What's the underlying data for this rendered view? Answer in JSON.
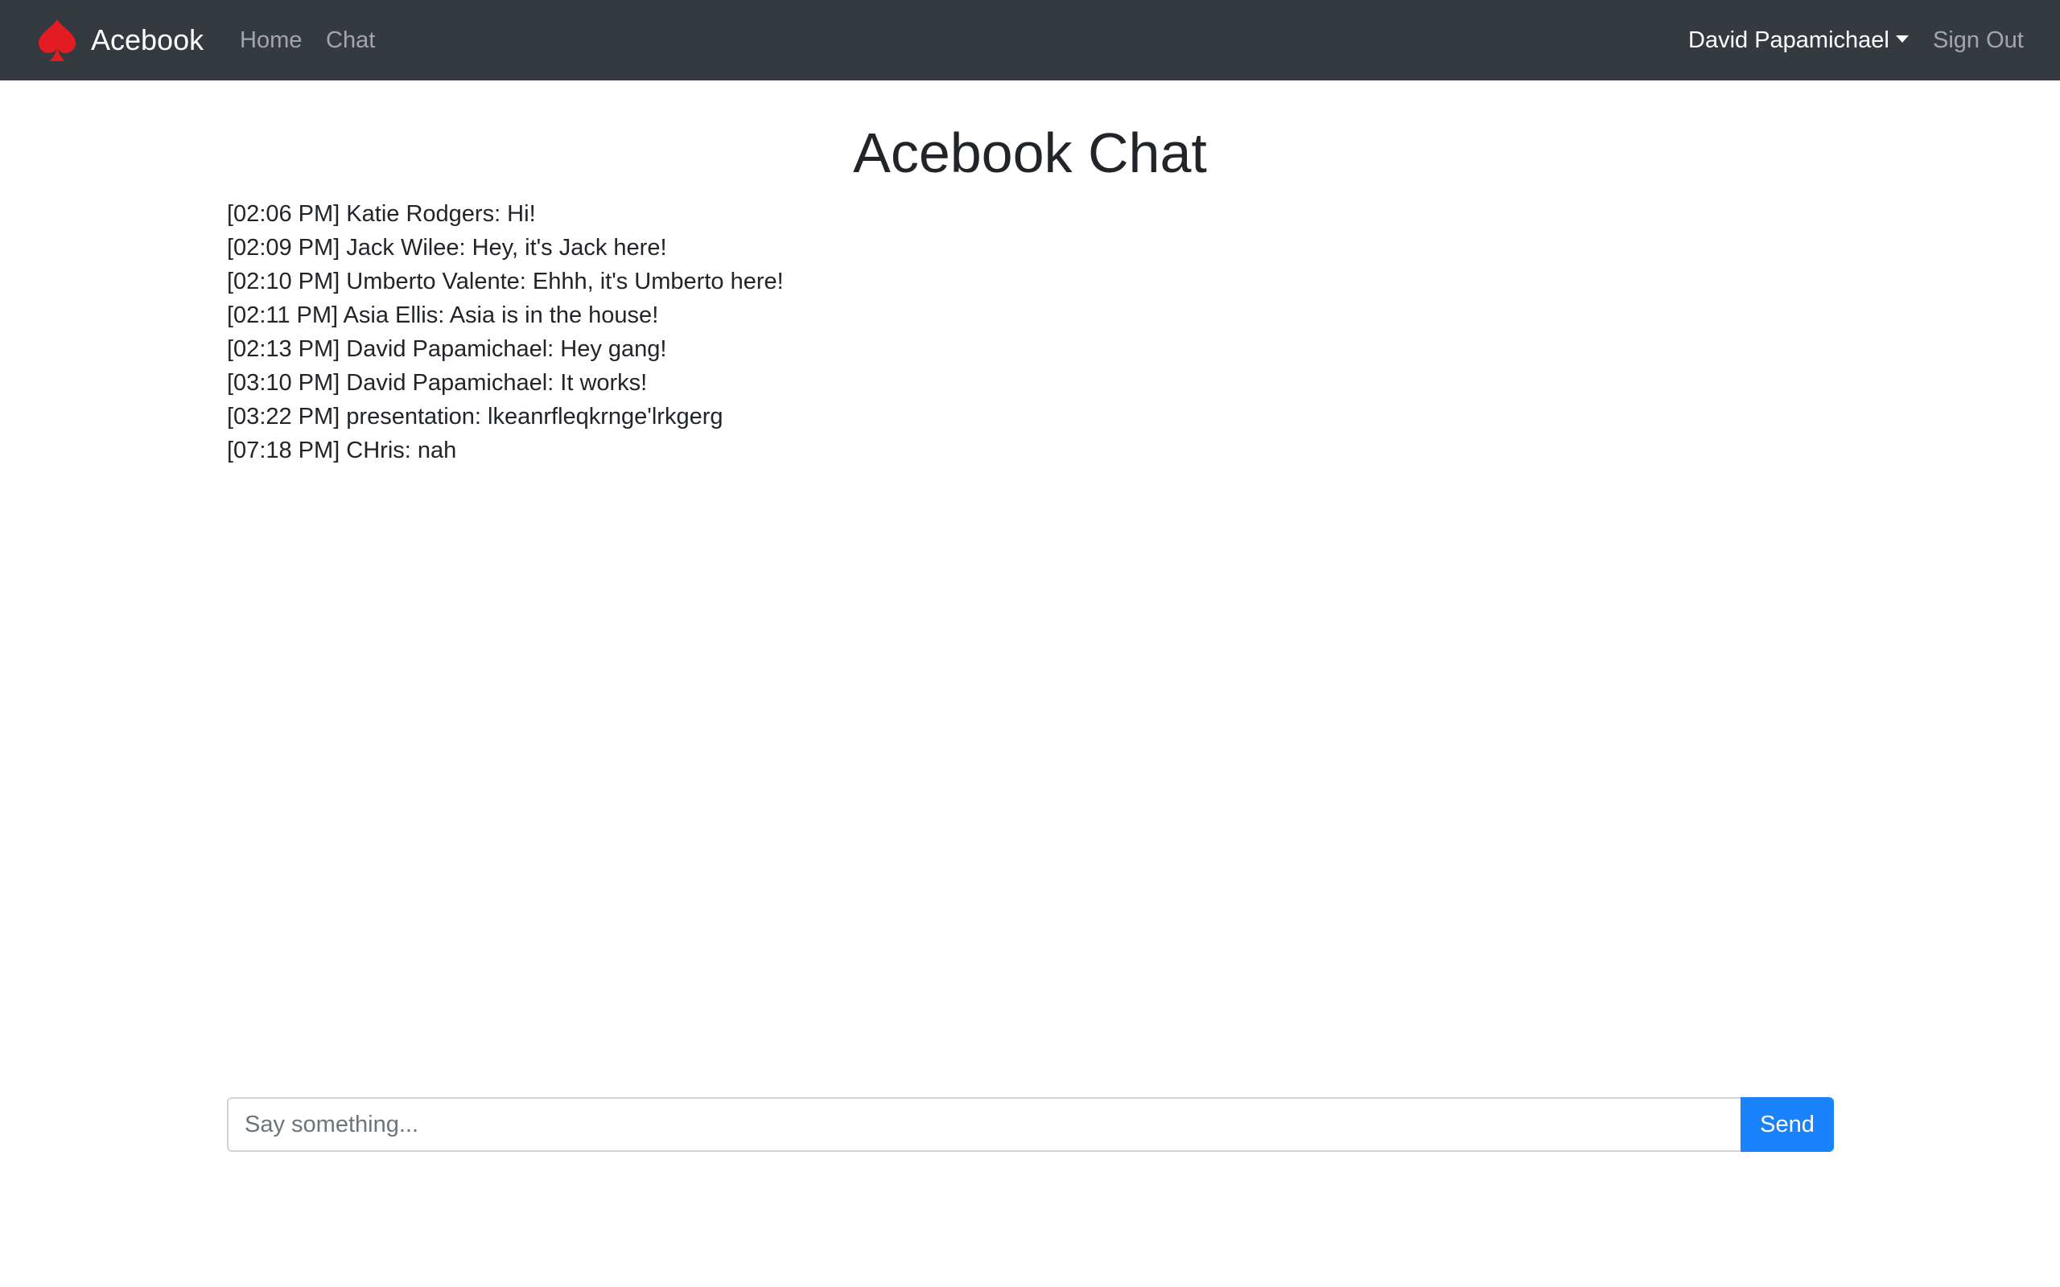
{
  "navbar": {
    "brand": "Acebook",
    "links": {
      "home": "Home",
      "chat": "Chat"
    },
    "user_name": "David Papamichael",
    "sign_out": "Sign Out",
    "background": "#343a40",
    "logo_icon": "spade-icon",
    "logo_color": "#e31b23"
  },
  "page": {
    "title": "Acebook Chat"
  },
  "messages": [
    "[02:06 PM] Katie Rodgers: Hi!",
    "[02:09 PM] Jack Wilee: Hey, it's Jack here!",
    "[02:10 PM] Umberto Valente: Ehhh, it's Umberto here!",
    "[02:11 PM] Asia Ellis: Asia is in the house!",
    "[02:13 PM] David Papamichael: Hey gang!",
    "[03:10 PM] David Papamichael: It works!",
    "[03:22 PM] presentation: lkeanrfleqkrnge'lrkgerg",
    "[07:18 PM] CHris: nah"
  ],
  "chat_form": {
    "placeholder": "Say something...",
    "value": "",
    "send_label": "Send",
    "send_color": "#1a82fb"
  }
}
